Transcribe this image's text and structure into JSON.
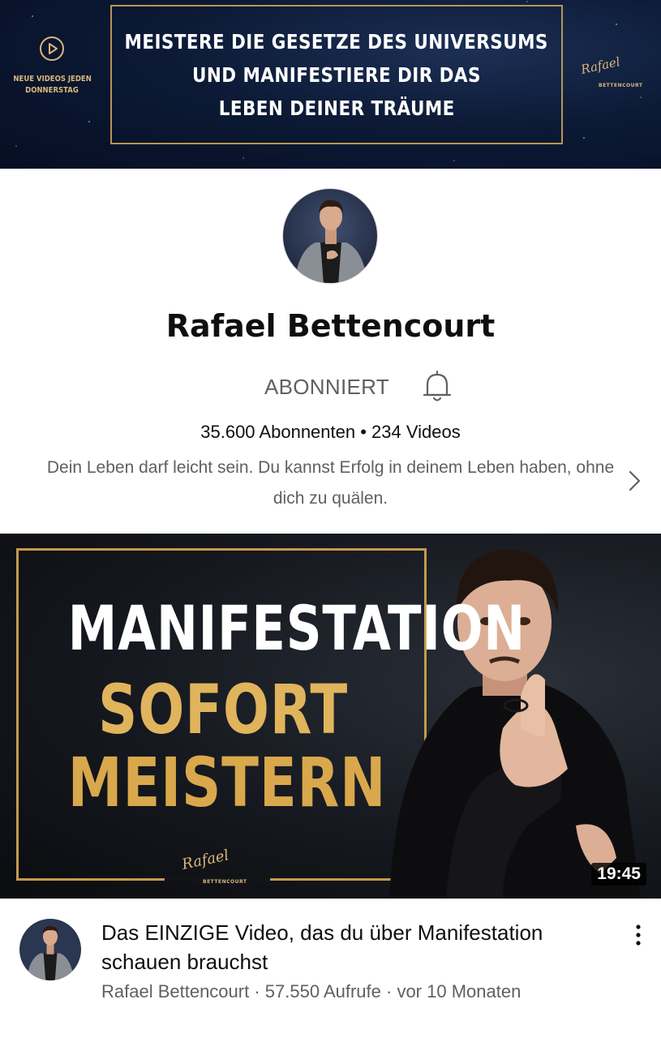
{
  "banner": {
    "headline_lines": [
      "MEISTERE DIE GESETZE DES UNIVERSUMS",
      "UND MANIFESTIERE DIR DAS",
      "LEBEN DEINER TRÄUME"
    ],
    "schedule_lines": [
      "NEUE VIDEOS JEDEN",
      "DONNERSTAG"
    ],
    "signature": "Rafael",
    "signature_sub": "BETTENCOURT"
  },
  "channel": {
    "name": "Rafael Bettencourt",
    "subscribe_label": "ABONNIERT",
    "stats": "35.600 Abonnenten • 234 Videos",
    "description": "Dein Leben darf leicht sein. Du kannst Erfolg in deinem Leben haben, ohne dich zu quälen."
  },
  "featured_video": {
    "thumbnail_lines": [
      "MANIFESTATION",
      "SOFORT",
      "MEISTERN"
    ],
    "thumbnail_signature": "Rafael",
    "thumbnail_signature_sub": "BETTENCOURT",
    "duration": "19:45",
    "title": "Das EINZIGE Video, das du über Manifestation schauen brauchst",
    "meta": "Rafael Bettencourt · 57.550 Aufrufe · vor 10 Monaten"
  },
  "icons": {
    "bell": "bell-icon",
    "chevron": "chevron-right-icon",
    "menu": "more-vert-icon",
    "play": "play-circle-icon"
  },
  "colors": {
    "gold": "#d9b779",
    "banner_bg": "#0c1a36",
    "secondary_text": "#606060"
  }
}
